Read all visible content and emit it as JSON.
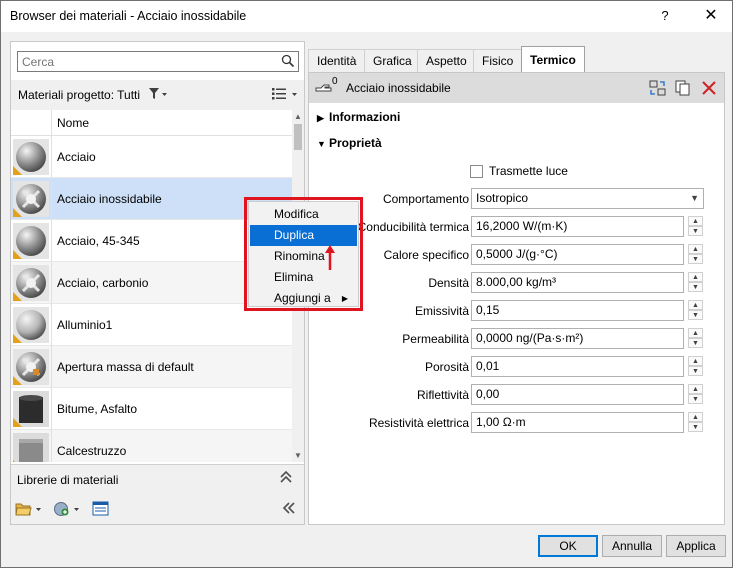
{
  "window": {
    "title": "Browser dei materiali - Acciaio inossidabile",
    "help_label": "?",
    "close_label": "✕"
  },
  "left": {
    "search_placeholder": "Cerca",
    "project_label": "Materiali progetto: Tutti",
    "column_name": "Nome",
    "materials": [
      {
        "name": "Acciaio",
        "thumb": "sphere-steel"
      },
      {
        "name": "Acciaio inossidabile",
        "thumb": "sphere-pattern",
        "selected": true
      },
      {
        "name": "Acciaio, 45-345",
        "thumb": "sphere-steel"
      },
      {
        "name": "Acciaio, carbonio",
        "thumb": "sphere-pattern"
      },
      {
        "name": "Alluminio1",
        "thumb": "sphere-aluminium"
      },
      {
        "name": "Apertura massa di default",
        "thumb": "sphere-pattern-color"
      },
      {
        "name": "Bitume, Asfalto",
        "thumb": "cube-dark"
      },
      {
        "name": "Calcestruzzo",
        "thumb": "cube-gray"
      }
    ],
    "libraries_label": "Librerie di materiali"
  },
  "tabs": [
    {
      "label": "Identità",
      "active": false
    },
    {
      "label": "Grafica",
      "active": false
    },
    {
      "label": "Aspetto",
      "active": false
    },
    {
      "label": "Fisico",
      "active": false
    },
    {
      "label": "Termico",
      "active": true
    }
  ],
  "asset": {
    "users_count": "0",
    "name": "Acciaio inossidabile"
  },
  "sections": {
    "info": "Informazioni",
    "props": "Proprietà"
  },
  "properties": {
    "transmits_light_label": "Trasmette luce",
    "behavior_label": "Comportamento",
    "behavior_value": "Isotropico",
    "fields": [
      {
        "label": "Conducibilità termica",
        "value": "16,2000 W/(m·K)"
      },
      {
        "label": "Calore specifico",
        "value": "0,5000 J/(g·°C)"
      },
      {
        "label": "Densità",
        "value": "8.000,00 kg/m³"
      },
      {
        "label": "Emissività",
        "value": "0,15"
      },
      {
        "label": "Permeabilità",
        "value": "0,0000 ng/(Pa·s·m²)"
      },
      {
        "label": "Porosità",
        "value": "0,01"
      },
      {
        "label": "Riflettività",
        "value": "0,00"
      },
      {
        "label": "Resistività elettrica",
        "value": "1,00 Ω·m"
      }
    ]
  },
  "context_menu": {
    "items": [
      "Modifica",
      "Duplica",
      "Rinomina",
      "Elimina",
      "Aggiungi a"
    ],
    "highlighted": "Duplica"
  },
  "buttons": {
    "ok": "OK",
    "cancel": "Annulla",
    "apply": "Applica"
  },
  "colors": {
    "selection": "#cde0f7",
    "menu_highlight": "#0a6fd4",
    "annotation_red": "#e0141e",
    "delete_red": "#d02020"
  }
}
